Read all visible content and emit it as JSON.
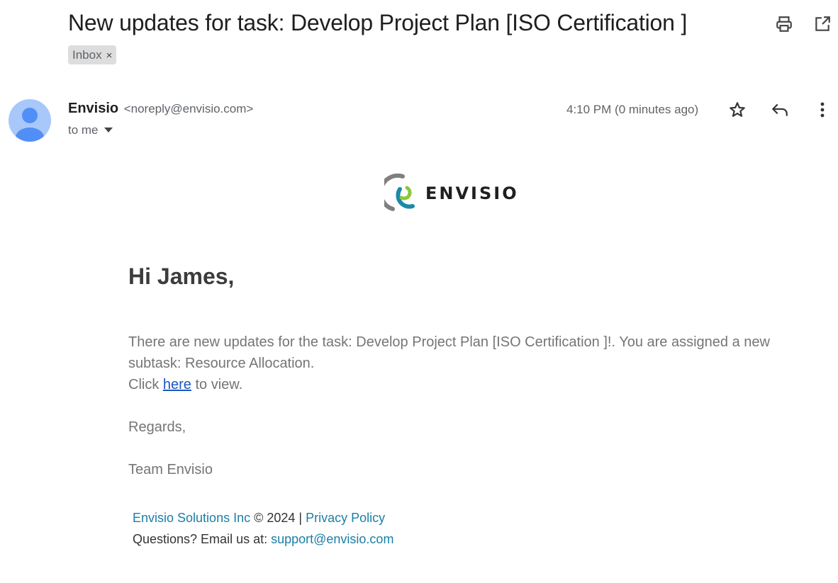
{
  "email": {
    "subject": "New updates for task: Develop Project Plan [ISO Certification ]",
    "label": "Inbox",
    "label_remove": "×",
    "toolbar": {
      "print_icon": "printer-icon",
      "popout_icon": "open-in-new-window-icon"
    },
    "sender": {
      "name": "Envisio",
      "email": "<noreply@envisio.com>",
      "recipient_text": "to me",
      "avatar_icon": "person-icon",
      "avatar_color": "#a8c7fa"
    },
    "timestamp": "4:10 PM (0 minutes ago)",
    "message_actions": {
      "star_icon": "star-icon",
      "reply_icon": "reply-icon",
      "more_icon": "more-vertical-icon"
    }
  },
  "body": {
    "logo_text": "ENVISIO",
    "greeting": "Hi James,",
    "paragraph": "There are new updates for the task: Develop Project Plan [ISO Certification ]!. You are assigned a new subtask: Resource Allocation.",
    "click_prefix": "Click ",
    "click_link": "here",
    "click_suffix": " to view.",
    "regards": "Regards,",
    "team": "Team Envisio"
  },
  "footer": {
    "company_link": "Envisio Solutions Inc",
    "copyright": " © 2024 | ",
    "privacy_link": "Privacy Policy",
    "questions_text": "Questions? Email us at: ",
    "support_email": "support@envisio.com"
  },
  "colors": {
    "link_body": "#1a56c2",
    "link_footer": "#1b7fa6",
    "logo_teal": "#1b8aa8",
    "logo_green": "#8dc63f",
    "logo_gray": "#7f7f7f"
  }
}
